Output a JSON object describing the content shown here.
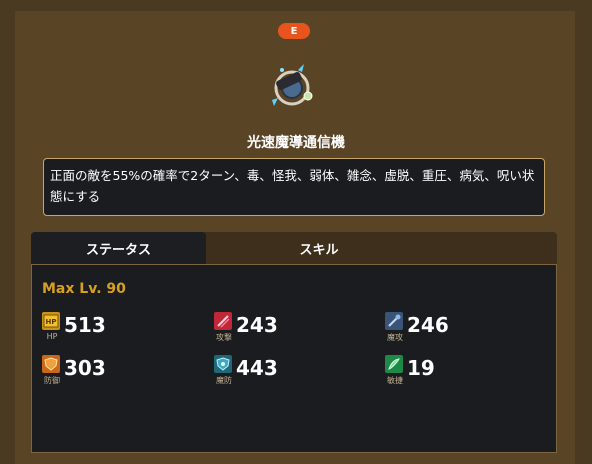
{
  "item": {
    "rank": "E",
    "name": "光速魔導通信機",
    "description": "正面の敵を55%の確率で2ターン、毒、怪我、弱体、雑念、虚脱、重圧、病気、呪い状態にする"
  },
  "tabs": [
    "ステータス",
    "スキル"
  ],
  "stats": {
    "max_level": "Max Lv. 90",
    "items": [
      {
        "label": "HP",
        "value": "513",
        "icon": "hp-icon"
      },
      {
        "label": "攻撃",
        "value": "243",
        "icon": "attack-icon"
      },
      {
        "label": "魔攻",
        "value": "246",
        "icon": "magic-attack-icon"
      },
      {
        "label": "防御",
        "value": "303",
        "icon": "defense-icon"
      },
      {
        "label": "魔防",
        "value": "443",
        "icon": "magic-defense-icon"
      },
      {
        "label": "敏捷",
        "value": "19",
        "icon": "agility-icon"
      }
    ]
  },
  "colors": {
    "rank_badge": "#e8541e",
    "max_level_text": "#d8a020",
    "background": "#4a3a22",
    "panel": "#5a4426",
    "box": "#1a1c20"
  }
}
